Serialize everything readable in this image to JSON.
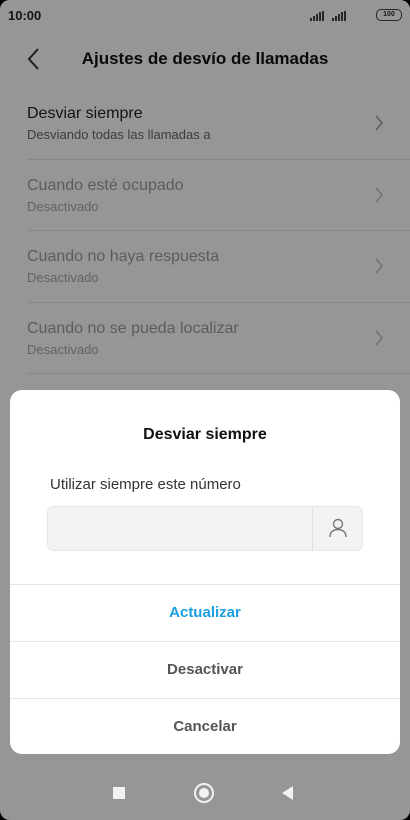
{
  "status_bar": {
    "time": "10:00",
    "battery": "100",
    "icons": [
      "signal-icon",
      "signal-icon",
      "battery-icon"
    ]
  },
  "header": {
    "title": "Ajustes de desvío de llamadas",
    "back_icon": "chevron-left-icon"
  },
  "list": {
    "items": [
      {
        "title": "Desviar siempre",
        "subtitle": "Desviando todas las llamadas a",
        "enabled": true
      },
      {
        "title": "Cuando esté ocupado",
        "subtitle": "Desactivado",
        "enabled": false
      },
      {
        "title": "Cuando no haya respuesta",
        "subtitle": "Desactivado",
        "enabled": false
      },
      {
        "title": "Cuando no se pueda localizar",
        "subtitle": "Desactivado",
        "enabled": false
      }
    ],
    "chevron_icon": "chevron-right-icon"
  },
  "dialog": {
    "title": "Desviar siempre",
    "label": "Utilizar siempre este número",
    "number_value": "",
    "contact_icon": "person-icon",
    "buttons": {
      "update": "Actualizar",
      "deactivate": "Desactivar",
      "cancel": "Cancelar"
    },
    "accent_color": "#1a9fe0"
  },
  "navbar": {
    "icons": [
      "square-icon",
      "circle-home-icon",
      "triangle-back-icon"
    ]
  }
}
